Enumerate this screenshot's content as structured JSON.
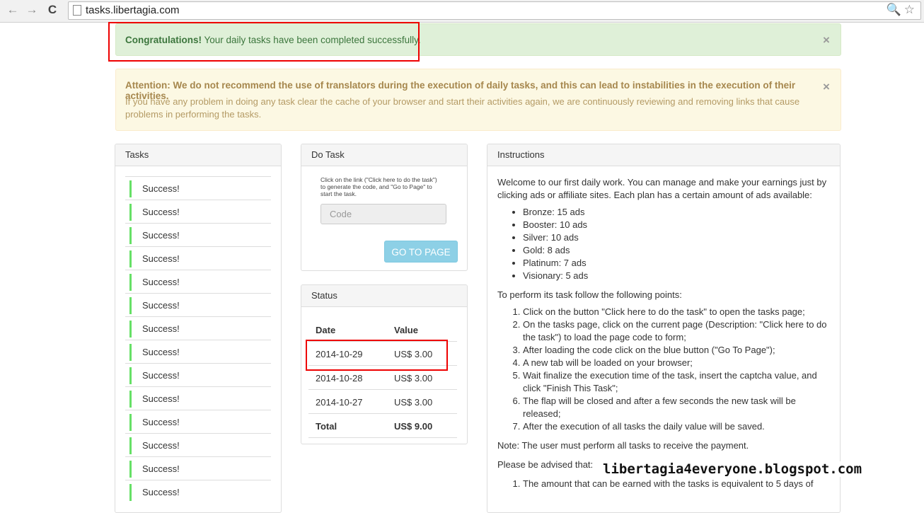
{
  "browser": {
    "url": "tasks.libertagia.com",
    "back_glyph": "←",
    "forward_glyph": "→",
    "reload_glyph": "C",
    "search_glyph": "🔍",
    "star_glyph": "☆"
  },
  "alerts": {
    "success_strong": "Congratulations!",
    "success_text": " Your daily tasks have been completed successfully.",
    "close_glyph": "×",
    "warning_heading": "Attention: We do not recommend the use of translators during the execution of daily tasks, and this can lead to instabilities in the execution of their activities.",
    "warning_body": "If you have any problem in doing any task clear the cache of your browser and start their activities again, we are continuously reviewing and removing links that cause problems in performing the tasks."
  },
  "tasks": {
    "heading": "Tasks",
    "items": [
      "Success!",
      "Success!",
      "Success!",
      "Success!",
      "Success!",
      "Success!",
      "Success!",
      "Success!",
      "Success!",
      "Success!",
      "Success!",
      "Success!",
      "Success!",
      "Success!"
    ]
  },
  "do_task": {
    "heading": "Do Task",
    "instructions": "Click on the link (\"Click here to do the task\") to generate the code, and \"Go to Page\" to start the task.",
    "code_placeholder": "Code",
    "go_button": "GO TO PAGE"
  },
  "status": {
    "heading": "Status",
    "columns": [
      "Date",
      "Value"
    ],
    "rows": [
      {
        "date": "2014-10-29",
        "value": "US$ 3.00"
      },
      {
        "date": "2014-10-28",
        "value": "US$ 3.00"
      },
      {
        "date": "2014-10-27",
        "value": "US$ 3.00"
      }
    ],
    "total_label": "Total",
    "total_value": "US$ 9.00"
  },
  "instructions": {
    "heading": "Instructions",
    "intro": "Welcome to our first daily work. You can manage and make your earnings just by clicking ads or affiliate sites. Each plan has a certain amount of ads available:",
    "plans": [
      "Bronze: 15 ads",
      "Booster: 10 ads",
      "Silver: 10 ads",
      "Gold: 8 ads",
      "Platinum: 7 ads",
      "Visionary: 5 ads"
    ],
    "steps_intro": "To perform its task follow the following points:",
    "steps": [
      "Click on the button \"Click here to do the task\" to open the tasks page;",
      "On the tasks page, click on the current page (Description: \"Click here to do the task\") to load the page code to form;",
      "After loading the code click on the blue button (\"Go To Page\");",
      "A new tab will be loaded on your browser;",
      "Wait finalize the execution time of the task, insert the captcha value, and click \"Finish This Task\";",
      "The flap will be closed and after a few seconds the new task will be released;",
      "After the execution of all tasks the daily value will be saved."
    ],
    "note": "Note: The user must perform all tasks to receive the payment.",
    "advised": "Please be advised that:",
    "advised_items": [
      "The amount that can be earned with the tasks is equivalent to 5 days of"
    ]
  },
  "watermark": "libertagia4everyone.blogspot.com"
}
